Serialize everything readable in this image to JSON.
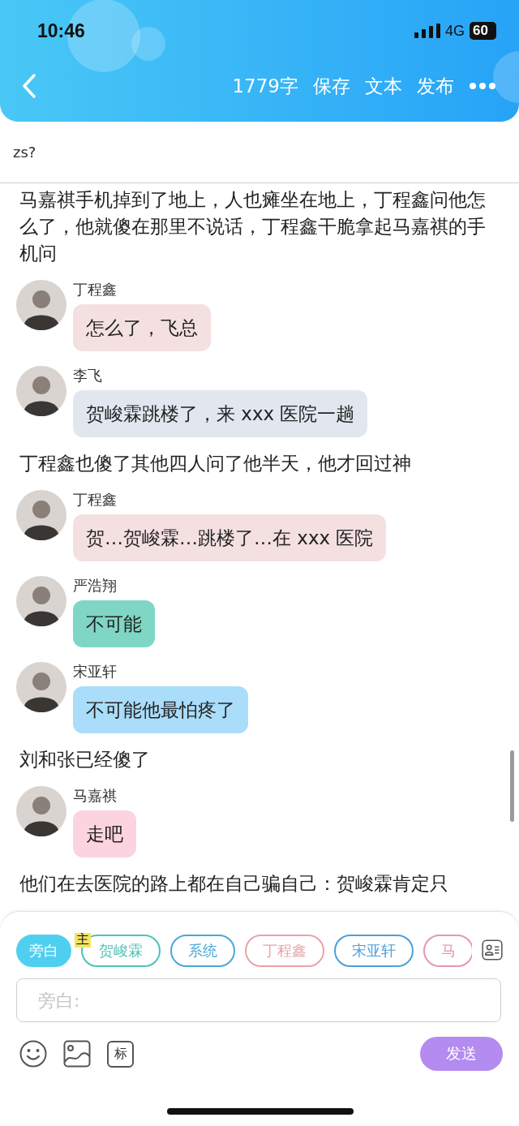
{
  "status_bar": {
    "time": "10:46",
    "network": "4G",
    "battery": "60"
  },
  "header": {
    "word_count": "1779字",
    "actions": [
      "保存",
      "文本",
      "发布"
    ]
  },
  "chapter_title": "zs?",
  "content": [
    {
      "kind": "narration",
      "text": "马嘉祺手机掉到了地上，人也瘫坐在地上，丁程鑫问他怎么了，他就傻在那里不说话，丁程鑫干脆拿起马嘉祺的手机问"
    },
    {
      "kind": "message",
      "speaker": "丁程鑫",
      "text": "怎么了，飞总",
      "color": "#f4e0e1"
    },
    {
      "kind": "message",
      "speaker": "李飞",
      "text": "贺峻霖跳楼了，来 xxx 医院一趟",
      "color": "#e2e7ef"
    },
    {
      "kind": "narration",
      "text": "丁程鑫也傻了其他四人问了他半天，他才回过神"
    },
    {
      "kind": "message",
      "speaker": "丁程鑫",
      "text": "贺…贺峻霖…跳楼了…在 xxx 医院",
      "color": "#f4e0e1"
    },
    {
      "kind": "message",
      "speaker": "严浩翔",
      "text": "不可能",
      "color": "#80d6c4"
    },
    {
      "kind": "message",
      "speaker": "宋亚轩",
      "text": "不可能他最怕疼了",
      "color": "#a9ddfa"
    },
    {
      "kind": "narration",
      "text": "刘和张已经傻了"
    },
    {
      "kind": "message",
      "speaker": "马嘉祺",
      "text": "走吧",
      "color": "#fbd4df"
    },
    {
      "kind": "narration",
      "text": "他们在去医院的路上都在自己骗自己：贺峻霖肯定只"
    }
  ],
  "composer": {
    "roles": [
      {
        "label": "旁白",
        "selected": true,
        "color": "#4fcfef"
      },
      {
        "label": "贺峻霖",
        "selected": false,
        "color": "#4cc3b5",
        "badge": "主"
      },
      {
        "label": "系统",
        "selected": false,
        "color": "#4aa8d8"
      },
      {
        "label": "丁程鑫",
        "selected": false,
        "color": "#e8a3aa"
      },
      {
        "label": "宋亚轩",
        "selected": false,
        "color": "#4aa0da"
      },
      {
        "label": "马",
        "selected": false,
        "color": "#e897ad"
      }
    ],
    "placeholder": "旁白:",
    "tag_tool": "标",
    "send": "发送"
  }
}
